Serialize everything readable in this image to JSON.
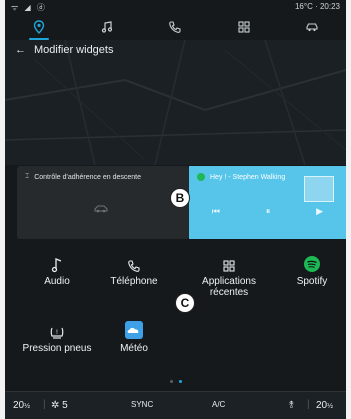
{
  "status": {
    "left_icons": "ᯤ ◢ ⓓ",
    "temperature": "16°C",
    "time": "20:23"
  },
  "nav": [
    {
      "name": "nav-navigation",
      "icon": "location-pin-icon",
      "active": true
    },
    {
      "name": "nav-music",
      "icon": "music-note-icon",
      "active": false
    },
    {
      "name": "nav-phone",
      "icon": "phone-icon",
      "active": false
    },
    {
      "name": "nav-apps",
      "icon": "apps-grid-icon",
      "active": false
    },
    {
      "name": "nav-vehicle",
      "icon": "car-icon",
      "active": false
    }
  ],
  "header": {
    "back": "←",
    "title": "Modifier widgets"
  },
  "widgets": {
    "left_title": "Contrôle d'adhérence en descente",
    "right_title": "Hey ! - Stephen Walking",
    "controls": {
      "prev": "⏮",
      "pause": "⏸",
      "next": "▶"
    }
  },
  "callouts": {
    "b": "B",
    "c": "C"
  },
  "apps": [
    {
      "label": "Audio"
    },
    {
      "label": "Téléphone"
    },
    {
      "label": "Applications récentes"
    },
    {
      "label": "Spotify"
    },
    {
      "label": "Pression pneus"
    },
    {
      "label": "Météo"
    }
  ],
  "bottom": {
    "left_temp": "20",
    "left_temp_suffix": "½",
    "fan": "5",
    "sync": "SYNC",
    "ac": "A/C",
    "right_temp": "20",
    "right_temp_suffix": "½"
  },
  "colors": {
    "accent": "#1fa6d9",
    "widget_blue": "#56c5e9",
    "spotify_green": "#1db954"
  }
}
